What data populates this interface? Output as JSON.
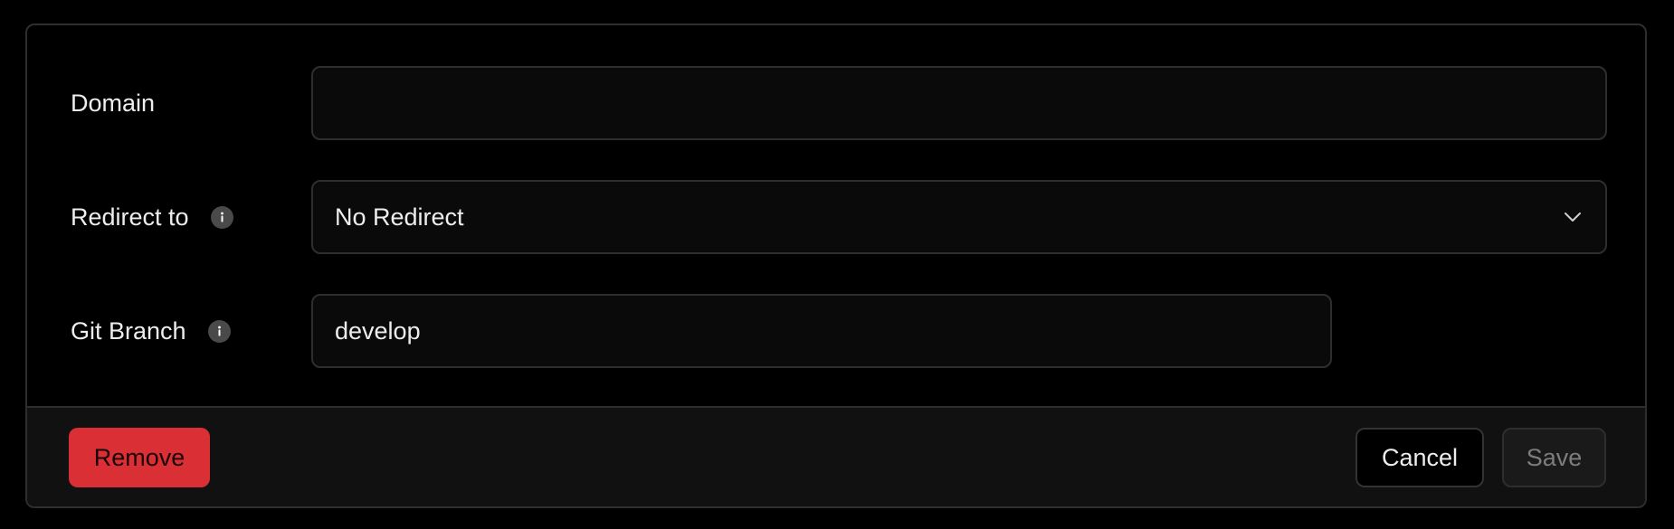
{
  "form": {
    "domain": {
      "label": "Domain",
      "value": "",
      "placeholder": ""
    },
    "redirect": {
      "label": "Redirect to",
      "selected": "No Redirect",
      "info_icon": "info-icon"
    },
    "git_branch": {
      "label": "Git Branch",
      "value": "develop",
      "info_icon": "info-icon"
    }
  },
  "footer": {
    "remove_label": "Remove",
    "cancel_label": "Cancel",
    "save_label": "Save"
  },
  "colors": {
    "background": "#000000",
    "card_border": "#2e2e2e",
    "field_background": "#0a0a0a",
    "footer_background": "#111111",
    "danger": "#da2f35",
    "text": "#ededed",
    "disabled_text": "#7d7d7d"
  }
}
